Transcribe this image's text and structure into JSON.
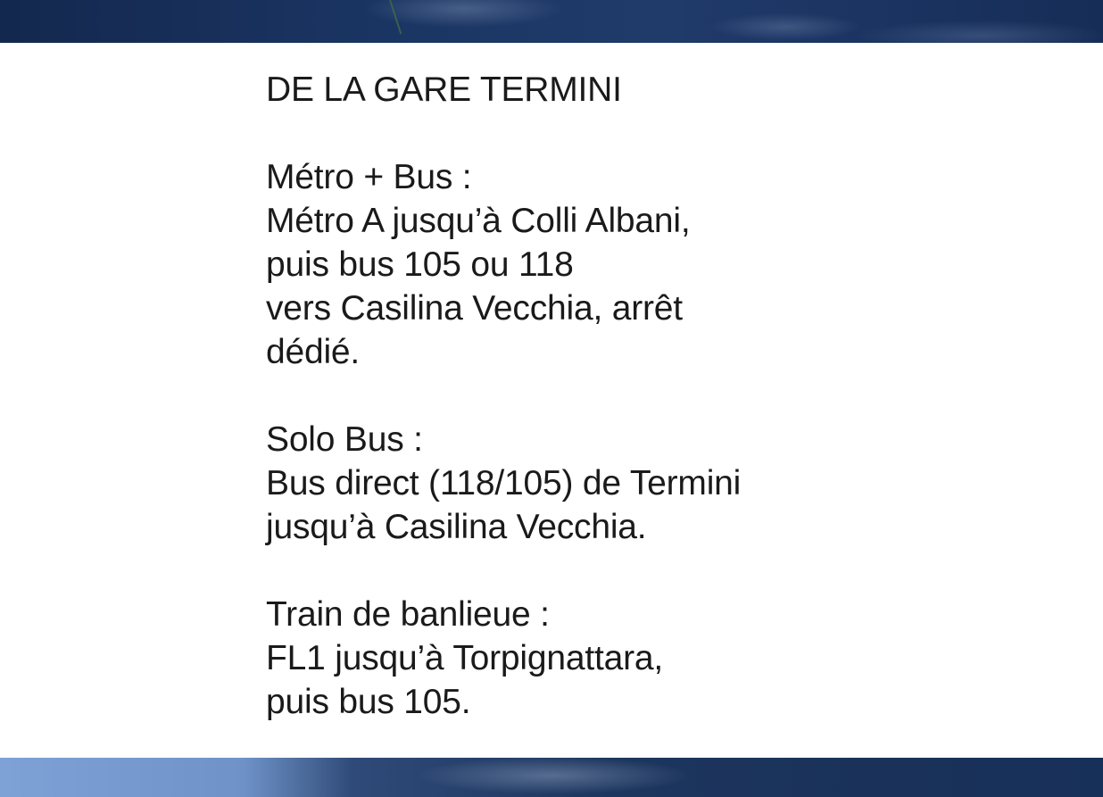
{
  "heading": "DE LA GARE TERMINI",
  "sections": [
    {
      "title": "Métro + Bus :",
      "lines": [
        "Métro A jusqu’à Colli Albani,",
        "puis bus 105 ou 118",
        "vers Casilina Vecchia, arrêt",
        "dédié."
      ]
    },
    {
      "title": "Solo Bus :",
      "lines": [
        "Bus direct (118/105) de Termini",
        "jusqu’à Casilina Vecchia."
      ]
    },
    {
      "title": "Train de banlieue :",
      "lines": [
        "FL1 jusqu’à Torpignattara,",
        "puis bus 105."
      ]
    }
  ]
}
